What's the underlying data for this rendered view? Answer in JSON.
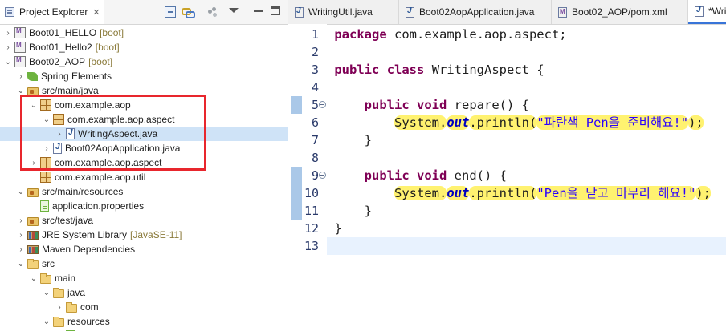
{
  "explorer": {
    "title": "Project Explorer",
    "close_glyph": "✕",
    "toolbar": [
      "collapse-all-icon",
      "link-with-editor-icon",
      "filters-icon",
      "view-menu-icon",
      "minimize-icon",
      "maximize-icon"
    ],
    "tree": [
      {
        "depth": 0,
        "twisty": "›",
        "icon": "project",
        "label": "Boot01_HELLO",
        "decor": "[boot]"
      },
      {
        "depth": 0,
        "twisty": "›",
        "icon": "project",
        "label": "Boot01_Hello2",
        "decor": "[boot]"
      },
      {
        "depth": 0,
        "twisty": "⌄",
        "icon": "project",
        "label": "Boot02_AOP",
        "decor": "[boot]"
      },
      {
        "depth": 1,
        "twisty": "›",
        "icon": "spring",
        "label": "Spring Elements",
        "decor": ""
      },
      {
        "depth": 1,
        "twisty": "⌄",
        "icon": "srcfolder",
        "label": "src/main/java",
        "decor": ""
      },
      {
        "depth": 2,
        "twisty": "⌄",
        "icon": "package",
        "label": "com.example.aop",
        "decor": ""
      },
      {
        "depth": 3,
        "twisty": "⌄",
        "icon": "package",
        "label": "com.example.aop.aspect",
        "decor": ""
      },
      {
        "depth": 4,
        "twisty": "›",
        "icon": "javafile",
        "label": "WritingAspect.java",
        "decor": "",
        "selected": true
      },
      {
        "depth": 3,
        "twisty": "›",
        "icon": "javafile",
        "label": "Boot02AopApplication.java",
        "decor": ""
      },
      {
        "depth": 2,
        "twisty": "›",
        "icon": "package",
        "label": "com.example.aop.aspect",
        "decor": ""
      },
      {
        "depth": 2,
        "twisty": "",
        "icon": "package",
        "label": "com.example.aop.util",
        "decor": ""
      },
      {
        "depth": 1,
        "twisty": "⌄",
        "icon": "srcfolder",
        "label": "src/main/resources",
        "decor": ""
      },
      {
        "depth": 2,
        "twisty": "",
        "icon": "props",
        "label": "application.properties",
        "decor": ""
      },
      {
        "depth": 1,
        "twisty": "›",
        "icon": "srcfolder",
        "label": "src/test/java",
        "decor": ""
      },
      {
        "depth": 1,
        "twisty": "›",
        "icon": "library",
        "label": "JRE System Library",
        "decor": "[JavaSE-11]"
      },
      {
        "depth": 1,
        "twisty": "›",
        "icon": "library",
        "label": "Maven Dependencies",
        "decor": ""
      },
      {
        "depth": 1,
        "twisty": "⌄",
        "icon": "folder",
        "label": "src",
        "decor": ""
      },
      {
        "depth": 2,
        "twisty": "⌄",
        "icon": "folder",
        "label": "main",
        "decor": ""
      },
      {
        "depth": 3,
        "twisty": "⌄",
        "icon": "folder",
        "label": "java",
        "decor": ""
      },
      {
        "depth": 4,
        "twisty": "›",
        "icon": "folder",
        "label": "com",
        "decor": ""
      },
      {
        "depth": 3,
        "twisty": "⌄",
        "icon": "folder",
        "label": "resources",
        "decor": ""
      },
      {
        "depth": 4,
        "twisty": "",
        "icon": "props",
        "label": "application.properties",
        "decor": ""
      }
    ]
  },
  "editor": {
    "tabs": [
      {
        "label": "WritingUtil.java",
        "icon": "java",
        "active": false
      },
      {
        "label": "Boot02AopApplication.java",
        "icon": "java",
        "active": false
      },
      {
        "label": "Boot02_AOP/pom.xml",
        "icon": "maven",
        "active": false
      },
      {
        "label": "*Writ",
        "icon": "java",
        "active": true
      }
    ],
    "lines": [
      {
        "num": "1",
        "tokens": [
          {
            "t": "package",
            "c": "kw"
          },
          {
            "t": " com.example.aop.aspect;"
          }
        ]
      },
      {
        "num": "2",
        "tokens": []
      },
      {
        "num": "3",
        "tokens": [
          {
            "t": "public",
            "c": "kw"
          },
          {
            "t": " "
          },
          {
            "t": "class",
            "c": "kw"
          },
          {
            "t": " WritingAspect {"
          }
        ]
      },
      {
        "num": "4",
        "tokens": []
      },
      {
        "num": "5",
        "fold": true,
        "tokens": [
          {
            "t": "    "
          },
          {
            "t": "public",
            "c": "kw"
          },
          {
            "t": " "
          },
          {
            "t": "void",
            "c": "kw"
          },
          {
            "t": " repare() {"
          }
        ]
      },
      {
        "num": "6",
        "tokens": [
          {
            "t": "        "
          },
          {
            "t": "System.",
            "hl": true
          },
          {
            "t": "out",
            "c": "fld",
            "hl": true
          },
          {
            "t": ".println(",
            "hl": true
          },
          {
            "t": "\"파란색 Pen을 준비해요!\"",
            "c": "str",
            "hl": true
          },
          {
            "t": ");",
            "hl": true
          }
        ]
      },
      {
        "num": "7",
        "tokens": [
          {
            "t": "    }"
          }
        ]
      },
      {
        "num": "8",
        "tokens": []
      },
      {
        "num": "9",
        "fold": true,
        "tokens": [
          {
            "t": "    "
          },
          {
            "t": "public",
            "c": "kw"
          },
          {
            "t": " "
          },
          {
            "t": "void",
            "c": "kw"
          },
          {
            "t": " end() {"
          }
        ]
      },
      {
        "num": "10",
        "tokens": [
          {
            "t": "        "
          },
          {
            "t": "System.",
            "hl": true
          },
          {
            "t": "out",
            "c": "fld",
            "hl": true
          },
          {
            "t": ".println(",
            "hl": true
          },
          {
            "t": "\"Pen을 닫고 마무리 해요!\"",
            "c": "str",
            "hl": true
          },
          {
            "t": ");",
            "hl": true
          }
        ]
      },
      {
        "num": "11",
        "tokens": [
          {
            "t": "    }"
          }
        ]
      },
      {
        "num": "12",
        "tokens": [
          {
            "t": "}"
          }
        ]
      },
      {
        "num": "13",
        "current": true,
        "tokens": []
      }
    ]
  },
  "colors": {
    "keyword": "#7f0055",
    "string": "#2a00ff",
    "static_field": "#0000c0",
    "highlight": "#fff270",
    "annotation_box": "#e8262d",
    "current_line": "#e8f2fe"
  }
}
